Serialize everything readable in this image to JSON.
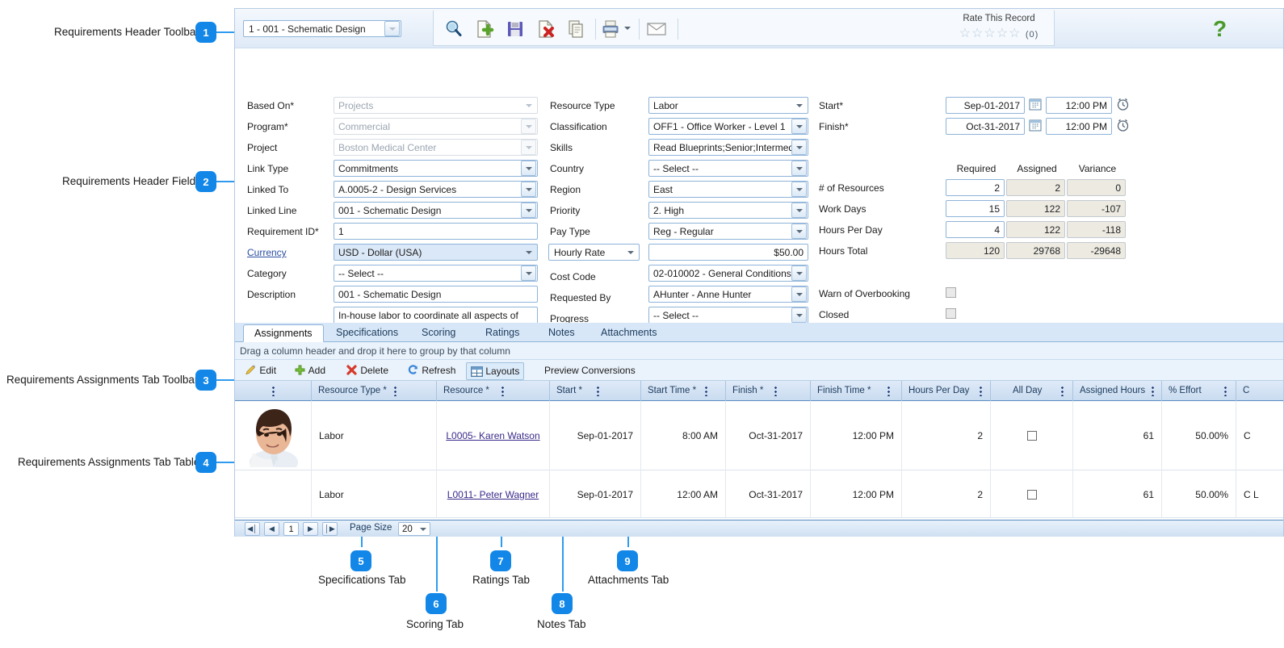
{
  "toolbar": {
    "record_selector": "1 -  001 - Schematic Design",
    "rate_label": "Rate This Record",
    "rating_stars": "☆☆☆☆☆",
    "rating_count": "(0)",
    "help_glyph": "?",
    "icons": [
      "search-icon",
      "new-record-icon",
      "save-icon",
      "delete-record-icon",
      "copy-icon",
      "print-icon",
      "email-icon"
    ]
  },
  "header_fields": {
    "left": [
      {
        "label": "Based On*",
        "value": "Projects",
        "state": "readonly",
        "type": "dropdown"
      },
      {
        "label": "Program*",
        "value": "Commercial",
        "state": "readonly",
        "type": "dropdown"
      },
      {
        "label": "Project",
        "value": "Boston Medical Center",
        "state": "readonly",
        "type": "dropdown"
      },
      {
        "label": "Link Type",
        "value": "Commitments",
        "state": "normal",
        "type": "dropdown"
      },
      {
        "label": "Linked To",
        "value": "A.0005-2 - Design Services",
        "state": "normal",
        "type": "dropdown"
      },
      {
        "label": "Linked Line",
        "value": "001 - Schematic Design",
        "state": "normal",
        "type": "dropdown"
      },
      {
        "label": "Requirement ID*",
        "value": "1",
        "state": "normal",
        "type": "text"
      },
      {
        "label": "Currency",
        "value": "USD - Dollar (USA)",
        "state": "selected",
        "type": "dropdown",
        "link": true
      },
      {
        "label": "Category",
        "value": "-- Select --",
        "state": "normal",
        "type": "dropdown"
      },
      {
        "label": "Description",
        "value": "001 - Schematic Design",
        "state": "normal",
        "type": "text"
      },
      {
        "label": "Scope",
        "value": "In-house labor to coordinate all aspects of schematic design development.",
        "state": "normal",
        "type": "textarea"
      }
    ],
    "middle": [
      {
        "label": "Resource Type",
        "value": "Labor",
        "type": "dropdown"
      },
      {
        "label": "Classification",
        "value": "OFF1 - Office Worker - Level 1",
        "type": "dropdown"
      },
      {
        "label": "Skills",
        "value": "Read Blueprints;Senior;Intermedi",
        "type": "dropdown"
      },
      {
        "label": "Country",
        "value": "-- Select --",
        "type": "dropdown"
      },
      {
        "label": "Region",
        "value": "East",
        "type": "dropdown"
      },
      {
        "label": "Priority",
        "value": "2. High",
        "type": "dropdown"
      },
      {
        "label": "Pay Type",
        "value": "Reg - Regular",
        "type": "dropdown"
      },
      {
        "label": "Hourly Rate",
        "value": "$50.00",
        "type": "rate"
      },
      {
        "label": "Cost Code",
        "value": "02-010002 - General Conditions",
        "type": "dropdown"
      },
      {
        "label": "Requested By",
        "value": "AHunter - Anne Hunter",
        "type": "dropdown"
      },
      {
        "label": "Progress",
        "value": "-- Select --",
        "type": "dropdown"
      }
    ],
    "dates": [
      {
        "label": "Start*",
        "date": "Sep-01-2017",
        "time": "12:00 PM"
      },
      {
        "label": "Finish*",
        "date": "Oct-31-2017",
        "time": "12:00 PM"
      }
    ],
    "resource_table": {
      "columns": [
        "Required",
        "Assigned",
        "Variance"
      ],
      "rows": [
        {
          "label": "# of Resources",
          "required": "2",
          "assigned": "2",
          "variance": "0"
        },
        {
          "label": "Work Days",
          "required": "15",
          "assigned": "122",
          "variance": "-107"
        },
        {
          "label": "Hours Per Day",
          "required": "4",
          "assigned": "122",
          "variance": "-118"
        },
        {
          "label": "Hours Total",
          "required": "120",
          "assigned": "29768",
          "variance": "-29648"
        }
      ]
    },
    "checkboxes": [
      {
        "label": "Warn of Overbooking",
        "checked": false
      },
      {
        "label": "Closed",
        "checked": false
      }
    ]
  },
  "tabs": [
    {
      "label": "Assignments",
      "active": true
    },
    {
      "label": "Specifications",
      "active": false
    },
    {
      "label": "Scoring",
      "active": false
    },
    {
      "label": "Ratings",
      "active": false
    },
    {
      "label": "Notes",
      "active": false
    },
    {
      "label": "Attachments",
      "active": false
    }
  ],
  "grid": {
    "group_hint": "Drag a column header and drop it here to group by that column",
    "toolbar": [
      {
        "label": "Edit",
        "icon": "pencil-icon"
      },
      {
        "label": "Add",
        "icon": "plus-icon"
      },
      {
        "label": "Delete",
        "icon": "x-icon"
      },
      {
        "label": "Refresh",
        "icon": "refresh-icon"
      },
      {
        "label": "Layouts",
        "icon": "layouts-icon",
        "boxed": true
      },
      {
        "label": "Preview Conversions",
        "icon": "none"
      }
    ],
    "columns": [
      "",
      "Resource Type *",
      "Resource *",
      "Start *",
      "Start Time *",
      "Finish *",
      "Finish Time *",
      "Hours Per Day",
      "All Day",
      "Assigned Hours",
      "% Effort",
      "C"
    ],
    "rows": [
      {
        "photo": true,
        "resource_type": "Labor",
        "resource": "L0005- Karen Watson",
        "start": "Sep-01-2017",
        "start_time": "8:00 AM",
        "finish": "Oct-31-2017",
        "finish_time": "12:00 PM",
        "hours_per_day": "2",
        "all_day": false,
        "assigned_hours": "61",
        "percent_effort": "50.00%",
        "last": "C"
      },
      {
        "photo": false,
        "resource_type": "Labor",
        "resource": "L0011- Peter Wagner",
        "start": "Sep-01-2017",
        "start_time": "12:00 AM",
        "finish": "Oct-31-2017",
        "finish_time": "12:00 PM",
        "hours_per_day": "2",
        "all_day": false,
        "assigned_hours": "61",
        "percent_effort": "50.00%",
        "last": "C L"
      }
    ]
  },
  "pager": {
    "first": "◀│",
    "prev": "◀",
    "page": "1",
    "next": "▶",
    "last": "│▶",
    "page_size_label": "Page Size",
    "page_size_value": "20"
  },
  "annotations": [
    {
      "num": "1",
      "label": "Requirements Header Toolbar"
    },
    {
      "num": "2",
      "label": "Requirements Header Fields"
    },
    {
      "num": "3",
      "label": "Requirements Assignments Tab Toolbar"
    },
    {
      "num": "4",
      "label": "Requirements Assignments Tab Table"
    },
    {
      "num": "5",
      "label": "Specifications Tab"
    },
    {
      "num": "6",
      "label": "Scoring Tab"
    },
    {
      "num": "7",
      "label": "Ratings Tab"
    },
    {
      "num": "8",
      "label": "Notes Tab"
    },
    {
      "num": "9",
      "label": "Attachments Tab"
    }
  ],
  "colors": {
    "accent": "#1287e8",
    "leader": "#2e9bf0",
    "tab_strip": "#d7e7f7",
    "link": "#3a2a8a"
  }
}
